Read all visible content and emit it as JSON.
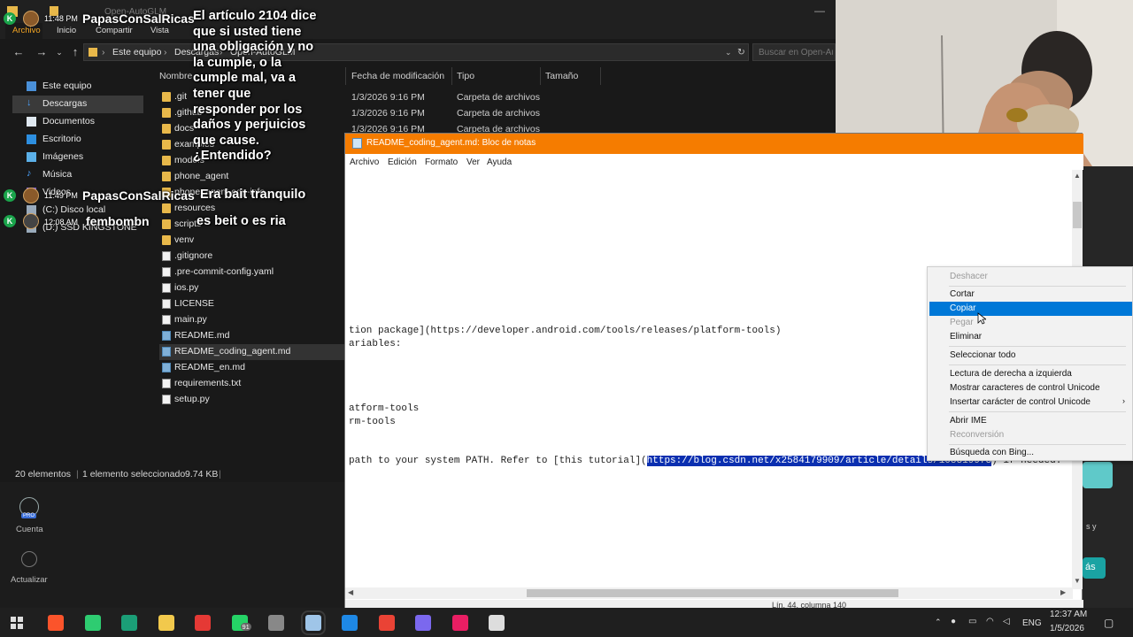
{
  "explorer": {
    "title": "Open-AutoGLM",
    "ribbon": [
      "Archivo",
      "Inicio",
      "Compartir",
      "Vista"
    ],
    "breadcrumb": [
      "Este equipo",
      "Descargas",
      "Open-AutoGLM"
    ],
    "search_placeholder": "Buscar en Open-Auto",
    "nav": [
      {
        "label": "Este equipo",
        "icon": "computer-icon"
      },
      {
        "label": "Descargas",
        "icon": "download-icon",
        "selected": true
      },
      {
        "label": "Documentos",
        "icon": "document-icon"
      },
      {
        "label": "Escritorio",
        "icon": "desktop-icon"
      },
      {
        "label": "Imágenes",
        "icon": "image-icon"
      },
      {
        "label": "Música",
        "icon": "music-icon"
      },
      {
        "label": "Videos",
        "icon": "video-icon"
      },
      {
        "label": "(C:) Disco local",
        "icon": "drive-icon"
      },
      {
        "label": "(D:) SSD KINGSTONE",
        "icon": "drive-icon"
      }
    ],
    "columns": [
      "Nombre",
      "Fecha de modificación",
      "Tipo",
      "Tamaño"
    ],
    "files": [
      {
        "name": ".git",
        "kind": "folder",
        "date": "1/3/2026 9:16 PM",
        "type": "Carpeta de archivos"
      },
      {
        "name": ".github",
        "kind": "folder",
        "date": "1/3/2026 9:16 PM",
        "type": "Carpeta de archivos"
      },
      {
        "name": "docs",
        "kind": "folder",
        "date": "1/3/2026 9:16 PM",
        "type": "Carpeta de archivos"
      },
      {
        "name": "examples",
        "kind": "folder"
      },
      {
        "name": "models",
        "kind": "folder"
      },
      {
        "name": "phone_agent",
        "kind": "folder"
      },
      {
        "name": "phone_agent.egg-info",
        "kind": "folder"
      },
      {
        "name": "resources",
        "kind": "folder"
      },
      {
        "name": "scripts",
        "kind": "folder"
      },
      {
        "name": "venv",
        "kind": "folder"
      },
      {
        "name": ".gitignore",
        "kind": "file"
      },
      {
        "name": ".pre-commit-config.yaml",
        "kind": "file"
      },
      {
        "name": "ios.py",
        "kind": "file"
      },
      {
        "name": "LICENSE",
        "kind": "file"
      },
      {
        "name": "main.py",
        "kind": "file"
      },
      {
        "name": "README.md",
        "kind": "md"
      },
      {
        "name": "README_coding_agent.md",
        "kind": "md",
        "selected": true
      },
      {
        "name": "README_en.md",
        "kind": "md"
      },
      {
        "name": "requirements.txt",
        "kind": "file"
      },
      {
        "name": "setup.py",
        "kind": "file"
      }
    ],
    "status": {
      "count": "20 elementos",
      "selection": "1 elemento seleccionado",
      "size": "9.74 KB"
    }
  },
  "chat": [
    {
      "time": "11:48 PM",
      "name": "PapasConSalRicas",
      "message": "El artículo 2104 dice que si usted tiene una obligación y no la cumple, o la cumple mal, va a tener que responder por los daños y perjuicios que cause. ¿Entendido?"
    },
    {
      "time": "11:49 PM",
      "name": "PapasConSalRicas",
      "message": "Era bait tranquilo"
    },
    {
      "time": "12:08 AM",
      "name": "fembombn",
      "message": "es beit o es ria"
    }
  ],
  "notepad": {
    "title": "README_coding_agent.md: Bloc de notas",
    "menu": [
      "Archivo",
      "Edición",
      "Formato",
      "Ver",
      "Ayuda"
    ],
    "lines": [
      {
        "text": "tion package](https://developer.android.com/tools/releases/platform-tools)"
      },
      {
        "text": "ariables:"
      },
      {
        "text": "atform-tools"
      },
      {
        "text": "rm-tools"
      },
      {
        "pre": "path to your system PATH. Refer to [this tutorial](",
        "sel": "https://blog.csdn.net/x2584179909/article/details/108319973",
        "post": ") if needed."
      }
    ],
    "status": "Lín. 44, columna 140"
  },
  "context_menu": [
    {
      "label": "Deshacer",
      "disabled": true
    },
    {
      "sep": true
    },
    {
      "label": "Cortar"
    },
    {
      "label": "Copiar",
      "hover": true
    },
    {
      "label": "Pegar",
      "disabled": true
    },
    {
      "label": "Eliminar"
    },
    {
      "sep": true
    },
    {
      "label": "Seleccionar todo"
    },
    {
      "sep": true
    },
    {
      "label": "Lectura de derecha a izquierda"
    },
    {
      "label": "Mostrar caracteres de control Unicode"
    },
    {
      "label": "Insertar carácter de control Unicode",
      "submenu": true
    },
    {
      "sep": true
    },
    {
      "label": "Abrir IME"
    },
    {
      "label": "Reconversión",
      "disabled": true
    },
    {
      "sep": true
    },
    {
      "label": "Búsqueda con Bing..."
    }
  ],
  "sidebar": {
    "account": "Cuenta",
    "update": "Actualizar",
    "pro_badge": "PRO"
  },
  "taskbar": {
    "apps": [
      {
        "name": "brave-icon",
        "color": "#fb542b"
      },
      {
        "name": "refresh-app-icon",
        "color": "#2ecc71"
      },
      {
        "name": "edge-icon",
        "color": "#1b9e77"
      },
      {
        "name": "file-explorer-icon",
        "color": "#f2c94c"
      },
      {
        "name": "red-app-icon",
        "color": "#e53935"
      },
      {
        "name": "whatsapp-icon",
        "color": "#25d366",
        "badge": "91"
      },
      {
        "name": "obs-icon",
        "color": "#888888"
      },
      {
        "name": "notepad-icon",
        "color": "#9fc5e8"
      },
      {
        "name": "vscode-icon",
        "color": "#1e88e5"
      },
      {
        "name": "chrome-icon",
        "color": "#ea4335"
      },
      {
        "name": "discord-icon",
        "color": "#7b68ee"
      },
      {
        "name": "game-app-icon",
        "color": "#e91e63"
      },
      {
        "name": "7zip-icon",
        "color": "#dddddd"
      }
    ],
    "language": "ENG",
    "time": "12:37 AM",
    "date": "1/5/2026"
  },
  "right_strip_text": [
    "s y",
    "ás"
  ],
  "colors": {
    "notepad_title": "#f57c00",
    "selection": "#0a2fb0",
    "menu_hover": "#0078d7",
    "chat_badge": "#1aa44b"
  }
}
